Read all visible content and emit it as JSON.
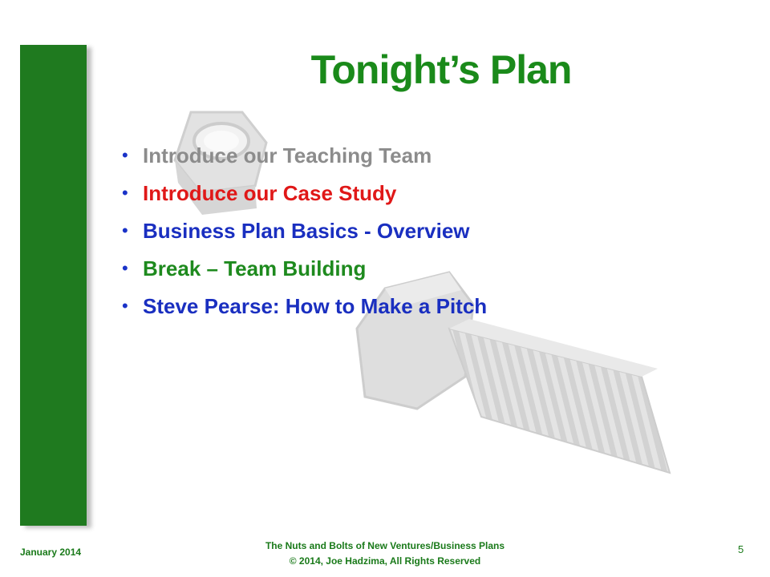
{
  "slide": {
    "title": "Tonight’s Plan",
    "bullets": [
      {
        "text": "Introduce our Teaching Team",
        "color": "#8c8c8c"
      },
      {
        "text": "Introduce our Case Study",
        "color": "#e01818"
      },
      {
        "text": "Business Plan Basics - Overview",
        "color": "#1a2fc0"
      },
      {
        "text": "Break – Team Building",
        "color": "#1e8a1e"
      },
      {
        "text": "Steve Pearse:  How to Make a Pitch",
        "color": "#1a2fc0"
      }
    ],
    "bullet_glyph": "•",
    "footer": {
      "date": "January 2014",
      "line1": "The Nuts and Bolts of New Ventures/Business Plans",
      "line2": "© 2014, Joe Hadzima, All Rights Reserved",
      "page_number": "5"
    }
  },
  "colors": {
    "sidebar": "#1f7a1f",
    "title": "#1a8a1a",
    "bullet_dot": "#1a33c8"
  },
  "icons": {
    "watermark": "nut-and-bolt-icon"
  }
}
